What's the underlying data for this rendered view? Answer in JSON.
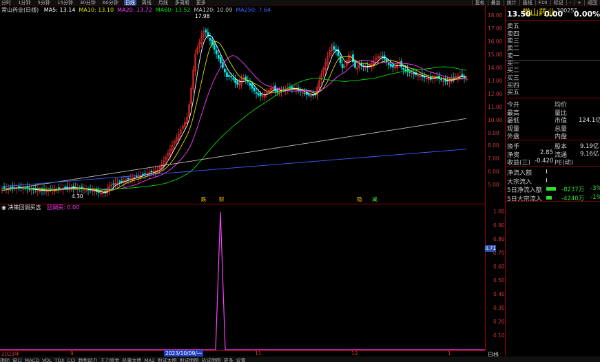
{
  "toolbar": {
    "timeframes": [
      "分时",
      "1分钟",
      "5分钟",
      "15分钟",
      "30分钟",
      "60分钟",
      "日线",
      "周线",
      "月线",
      "多周期",
      "更多"
    ],
    "active_timeframe": "日线",
    "right_buttons": [
      "复权",
      "叠加",
      "统计",
      "画线",
      "F10",
      "标记",
      "-",
      "+",
      "返回"
    ]
  },
  "chart": {
    "title": "常山药业(日线)",
    "ma_legend": [
      {
        "label": "MA5: 13.14",
        "color": "#ffffff"
      },
      {
        "label": "MA10: 13.10",
        "color": "#e0e000"
      },
      {
        "label": "MA20: 13.72",
        "color": "#ff40ff"
      },
      {
        "label": "MA60: 13.52",
        "color": "#00e000"
      },
      {
        "label": "MA120: 10.09",
        "color": "#c0c0c0"
      },
      {
        "label": "MA250: 7.64",
        "color": "#4060ff"
      }
    ],
    "high_label": "17.98",
    "low_label": "4.30",
    "price_ticks": [
      "18.00",
      "17.00",
      "16.00",
      "15.00",
      "14.00",
      "13.00",
      "12.00",
      "11.00",
      "10.00",
      "9.00",
      "8.00",
      "7.00",
      "6.00",
      "5.00"
    ],
    "events": [
      {
        "label": "跌",
        "color": "#ffd000"
      },
      {
        "label": "财",
        "color": "#ffd000"
      },
      {
        "label": "隐",
        "color": "#ffd000"
      },
      {
        "label": "减",
        "color": "#40ff40"
      }
    ]
  },
  "indicator": {
    "title": "决策回调买选",
    "param_label": "回调买: 0.00",
    "ticks": [
      "1.00",
      "0.90",
      "0.80",
      "0.70",
      "0.60",
      "0.50",
      "0.40",
      "0.30",
      "0.20",
      "0.10"
    ],
    "current_value": "0.71"
  },
  "xaxis": {
    "labels": [
      "2023年",
      "9",
      "11",
      "12",
      "1"
    ],
    "selected_date": "2023/10/09/一"
  },
  "bottom_tabs": [
    "指标",
    "窗口",
    "MACD",
    "VOL",
    "TDX",
    "CCI",
    "趋势动力",
    "主力资金",
    "扒量大团",
    "MA2",
    "别试大图",
    "别试明图",
    "扒试明图",
    "更多",
    "设置"
  ],
  "daily_label": "日线",
  "quote": {
    "name": "常山药业",
    "code": "300255",
    "price": "13.50",
    "change": "0.00",
    "pct": "0.00%",
    "order_book": [
      "卖五",
      "卖四",
      "卖三",
      "卖二",
      "卖一",
      "买一",
      "买二",
      "买三",
      "买四",
      "买五"
    ],
    "stats_left": [
      "今开",
      "最高",
      "最低",
      "现量",
      "外盘",
      "换手",
      "净资",
      "收益(三)"
    ],
    "stats_right": [
      "均价",
      "量比",
      "市值",
      "总量",
      "内盘",
      "股本",
      "流通",
      "PE(动)"
    ],
    "market_cap": "124.1亿",
    "turnover_vals": {
      "shares": "9.19亿",
      "net_asset": "2.85",
      "float": "9.16亿",
      "eps": "-0.420"
    },
    "flows": [
      {
        "label": "净流入额",
        "value": "",
        "pct": ""
      },
      {
        "label": "大宗流入",
        "value": "",
        "pct": ""
      },
      {
        "label": "5日净流入额",
        "value": "-8237万",
        "pct": "-3%"
      },
      {
        "label": "5日大宗流入",
        "value": "-4240万",
        "pct": "-1%"
      }
    ]
  },
  "colors": {
    "up": "#ff3030",
    "down": "#00e8e8",
    "grid_border": "#a00000"
  }
}
